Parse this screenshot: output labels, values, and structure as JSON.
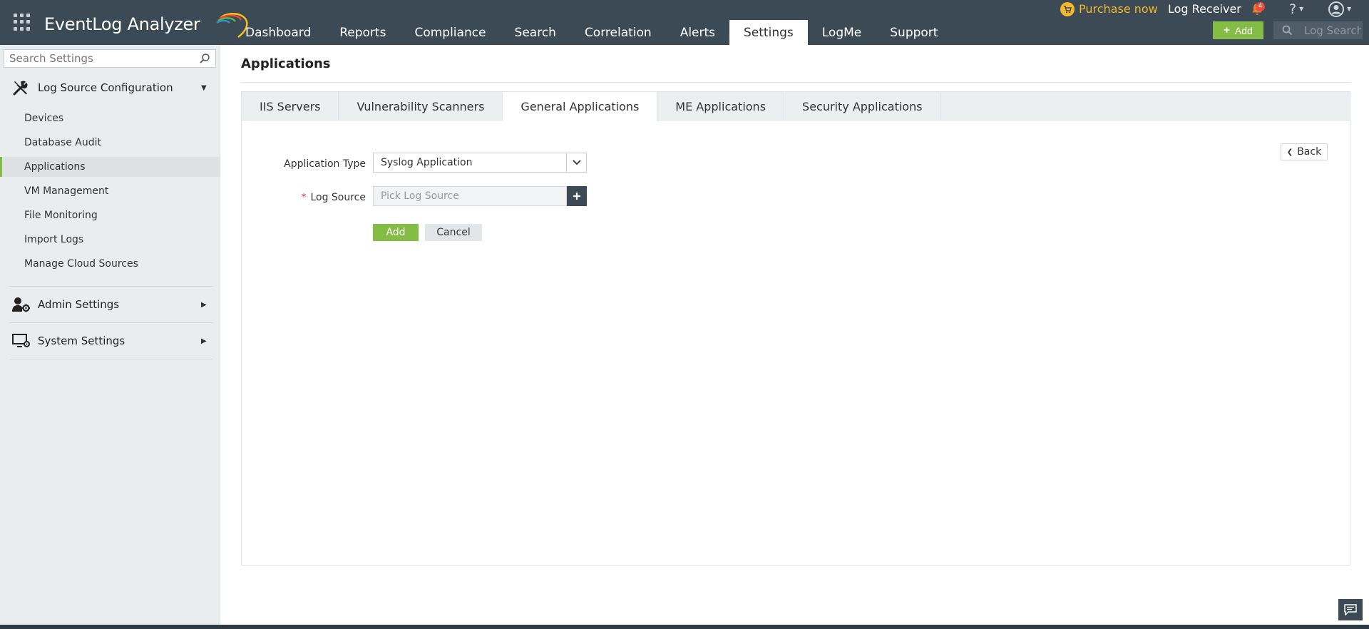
{
  "app": {
    "title": "EventLog Analyzer"
  },
  "nav": {
    "items": [
      {
        "label": "Dashboard"
      },
      {
        "label": "Reports"
      },
      {
        "label": "Compliance"
      },
      {
        "label": "Search"
      },
      {
        "label": "Correlation"
      },
      {
        "label": "Alerts"
      },
      {
        "label": "Settings",
        "active": true
      },
      {
        "label": "LogMe"
      },
      {
        "label": "Support"
      }
    ]
  },
  "header": {
    "purchase_label": "Purchase now",
    "log_receiver_label": "Log Receiver",
    "notification_count": "4",
    "help_label": "?",
    "add_label": "Add",
    "search_placeholder": "Log Search"
  },
  "sidebar": {
    "search_placeholder": "Search Settings",
    "groups": [
      {
        "label": "Log Source Configuration",
        "expanded": true,
        "icon": "tools-icon",
        "items": [
          {
            "label": "Devices"
          },
          {
            "label": "Database Audit"
          },
          {
            "label": "Applications",
            "active": true
          },
          {
            "label": "VM Management"
          },
          {
            "label": "File Monitoring"
          },
          {
            "label": "Import Logs"
          },
          {
            "label": "Manage Cloud Sources"
          }
        ]
      },
      {
        "label": "Admin Settings",
        "expanded": false,
        "icon": "user-gear-icon"
      },
      {
        "label": "System Settings",
        "expanded": false,
        "icon": "monitor-gear-icon"
      }
    ]
  },
  "main": {
    "title": "Applications",
    "tabs": [
      {
        "label": "IIS Servers"
      },
      {
        "label": "Vulnerability Scanners"
      },
      {
        "label": "General Applications",
        "active": true
      },
      {
        "label": "ME Applications"
      },
      {
        "label": "Security Applications"
      }
    ],
    "back_label": "Back",
    "form": {
      "application_type_label": "Application Type",
      "application_type_value": "Syslog Application",
      "log_source_label": "Log Source",
      "log_source_required_mark": "*",
      "log_source_placeholder": "Pick Log Source",
      "add_label": "Add",
      "cancel_label": "Cancel"
    }
  },
  "colors": {
    "topbar": "#3b4a55",
    "accent_green": "#84bd45",
    "purchase_yellow": "#f5b72b",
    "sidebar_bg": "#e9edef",
    "badge_red": "#e94c3d"
  }
}
